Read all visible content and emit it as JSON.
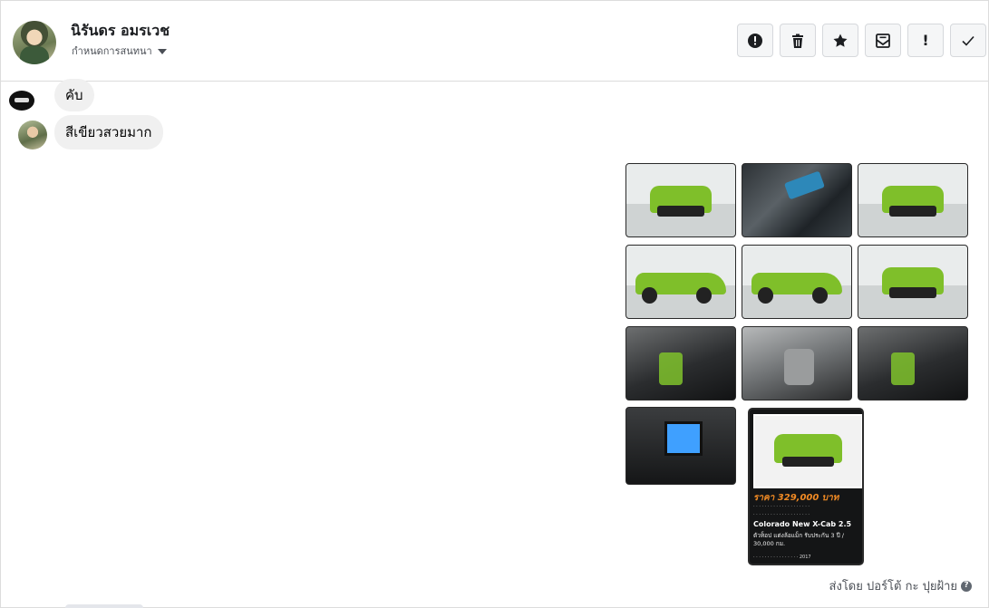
{
  "header": {
    "contact_name": "นิรันดร อมรเวช",
    "subtitle": "กำหนดการสนทนา",
    "actions": [
      {
        "name": "report-button",
        "icon": "alert-circle-icon"
      },
      {
        "name": "delete-button",
        "icon": "trash-icon"
      },
      {
        "name": "star-button",
        "icon": "star-icon"
      },
      {
        "name": "mark-unread-button",
        "icon": "envelope-icon"
      },
      {
        "name": "important-button",
        "icon": "exclamation-icon",
        "label": "!"
      },
      {
        "name": "done-button",
        "icon": "check-icon"
      }
    ]
  },
  "messages": [
    {
      "sender": "page",
      "text": "คับ"
    },
    {
      "sender": "customer",
      "text": "สีเขียวสวยมาก"
    }
  ],
  "attachments": {
    "image_count": 11,
    "promo_card": {
      "price": "ราคา 329,000 บาท",
      "title": "Colorado New X-Cab 2.5",
      "description": "ตัวท็อป แต่งล้อแม็ก รับประกัน 3 ปี / 30,000 กม.",
      "model_year": "2017"
    }
  },
  "footer": {
    "sent_by": "ส่งโดย ปอร์โต้ กะ ปุยฝ้าย"
  }
}
